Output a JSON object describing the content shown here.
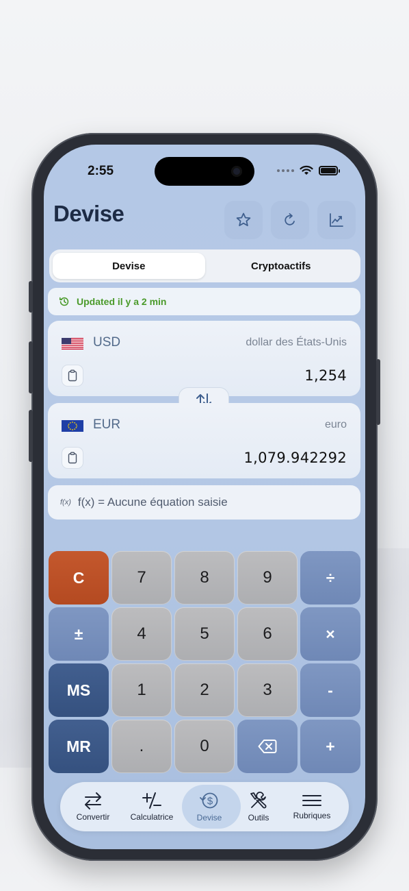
{
  "status_bar": {
    "time": "2:55"
  },
  "header": {
    "title": "Devise",
    "buttons": [
      {
        "icon": "star-icon"
      },
      {
        "icon": "refresh-icon"
      },
      {
        "icon": "chart-icon"
      }
    ]
  },
  "segment": {
    "options": [
      "Devise",
      "Cryptoactifs"
    ],
    "selected": "Devise"
  },
  "updated": {
    "text": "Updated il y a 2 min",
    "color": "#4a9a2a"
  },
  "from": {
    "code": "USD",
    "name": "dollar des États-Unis",
    "amount": "1,254",
    "flag": "us-flag"
  },
  "to": {
    "code": "EUR",
    "name": "euro",
    "amount": "1,079.942292",
    "flag": "eu-flag"
  },
  "equation": {
    "prefix": "f(x)",
    "text": "f(x) = Aucune équation saisie"
  },
  "keypad": {
    "rows": [
      [
        "C",
        "7",
        "8",
        "9",
        "÷"
      ],
      [
        "±",
        "4",
        "5",
        "6",
        "×"
      ],
      [
        "MS",
        "1",
        "2",
        "3",
        "-"
      ],
      [
        "MR",
        ".",
        "0",
        "backspace-icon",
        "+"
      ]
    ],
    "colors": {
      "clear": "#b44a21",
      "operator": "#6f88b6",
      "memory": "#35517f",
      "digit": "#adaeb1"
    }
  },
  "tabbar": {
    "items": [
      {
        "label": "Convertir",
        "icon": "convert-arrows-icon"
      },
      {
        "label": "Calculatrice",
        "icon": "plus-minus-icon"
      },
      {
        "label": "Devise",
        "icon": "currency-refresh-icon",
        "active": true
      },
      {
        "label": "Outils",
        "icon": "tools-icon"
      },
      {
        "label": "Rubriques",
        "icon": "menu-lines-icon"
      }
    ]
  }
}
